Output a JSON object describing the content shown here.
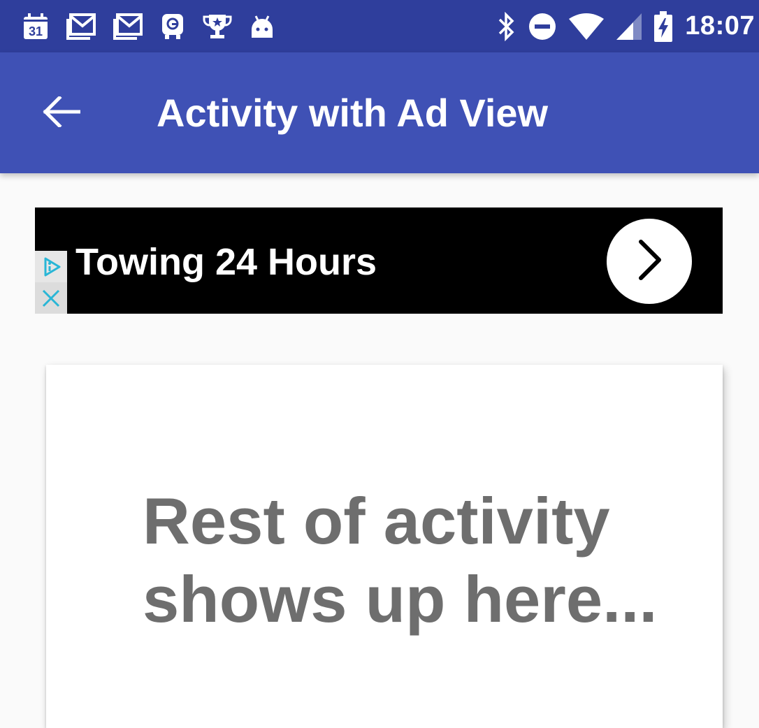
{
  "status_bar": {
    "calendar_day": "31",
    "time": "18:07",
    "left_icons": [
      "calendar-icon",
      "gmail-icon",
      "gmail-icon",
      "transit-icon",
      "trophy-icon",
      "android-icon"
    ],
    "right_icons": [
      "bluetooth-icon",
      "do-not-disturb-icon",
      "wifi-icon",
      "cell-signal-icon",
      "battery-charging-icon"
    ]
  },
  "app_bar": {
    "title": "Activity with Ad View",
    "back_icon": "arrow-back-icon"
  },
  "ad": {
    "headline": "Towing 24 Hours",
    "choices_icon": "ad-choices-icon",
    "close_icon": "close-icon",
    "action_icon": "chevron-right-icon"
  },
  "content": {
    "text": "Rest of activity shows up here..."
  },
  "colors": {
    "status_bar": "#2f3e9c",
    "app_bar": "#3f51b5",
    "background": "#fafafa",
    "ad_background": "#000000",
    "ad_badge": "#29b6d6",
    "content_text": "#6e6e6e"
  }
}
